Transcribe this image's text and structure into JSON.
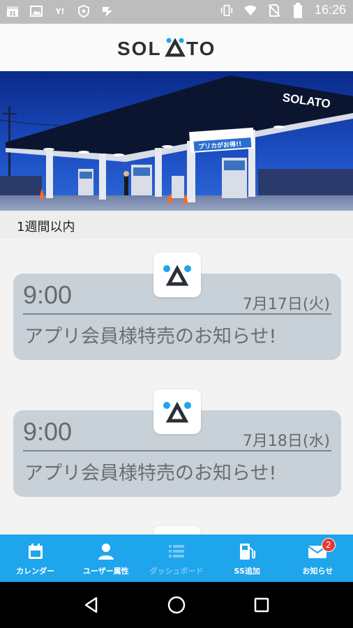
{
  "status_bar": {
    "time": "16:26",
    "left_icons": [
      "calendar-icon",
      "image-icon",
      "yahoo-icon",
      "shield-icon",
      "bolt-icon"
    ],
    "right_icons": [
      "vibrate-icon",
      "wifi-icon",
      "no-sim-icon",
      "battery-icon"
    ],
    "calendar_day": "31",
    "yahoo_label": "Y!"
  },
  "header": {
    "logo_text": "SOLATO"
  },
  "hero": {
    "canopy_sign": "SOLATO",
    "banner_text": "プリカがお得!!"
  },
  "section": {
    "label": "1週間以内"
  },
  "notices": [
    {
      "time": "9:00",
      "date": "7月17日(火)",
      "title": "アプリ会員様特売のお知らせ!"
    },
    {
      "time": "9:00",
      "date": "7月18日(水)",
      "title": "アプリ会員様特売のお知らせ!"
    }
  ],
  "tabs": [
    {
      "label": "カレンダー",
      "icon": "calendar-icon",
      "enabled": true
    },
    {
      "label": "ユーザー属性",
      "icon": "person-icon",
      "enabled": true
    },
    {
      "label": "ダッシュボード",
      "icon": "list-icon",
      "enabled": false
    },
    {
      "label": "SS追加",
      "icon": "gas-pump-icon",
      "enabled": true
    },
    {
      "label": "お知らせ",
      "icon": "mail-icon",
      "enabled": true,
      "badge": "2"
    }
  ],
  "colors": {
    "tab_bar": "#1ea5ec",
    "card_bg": "#c8d0d8",
    "logo_dot": "#1ea5ec",
    "badge": "#e53935"
  }
}
